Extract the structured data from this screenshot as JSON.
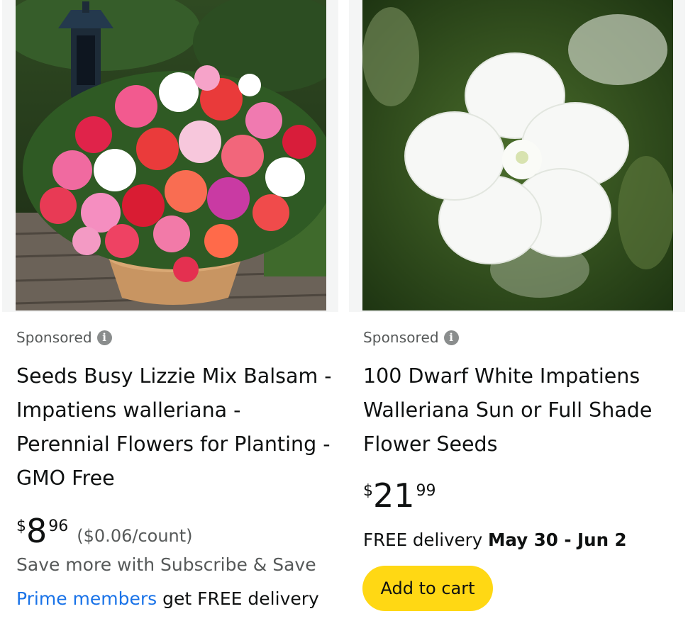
{
  "products": [
    {
      "sponsored_label": "Sponsored",
      "title": "Seeds Busy Lizzie Mix Balsam - Impatiens walleriana - Perennial Flowers for Planting - GMO Free",
      "price_symbol": "$",
      "price_whole": "8",
      "price_fraction": "96",
      "unit_price": "($0.06/count)",
      "subscribe_text": "Save more with Subscribe & Save",
      "prime_link": "Prime members",
      "prime_text": " get FREE delivery"
    },
    {
      "sponsored_label": "Sponsored",
      "title": "100 Dwarf White Impatiens Walleriana Sun or Full Shade Flower Seeds",
      "price_symbol": "$",
      "price_whole": "21",
      "price_fraction": "99",
      "delivery_prefix": "FREE delivery ",
      "delivery_dates": "May 30 - Jun 2",
      "add_to_cart": "Add to cart"
    }
  ],
  "colors": {
    "add_to_cart_bg": "#ffd814",
    "link": "#1a73e8",
    "secondary_text": "#565959",
    "primary_text": "#0f1111"
  },
  "icons": [
    "info-icon"
  ]
}
